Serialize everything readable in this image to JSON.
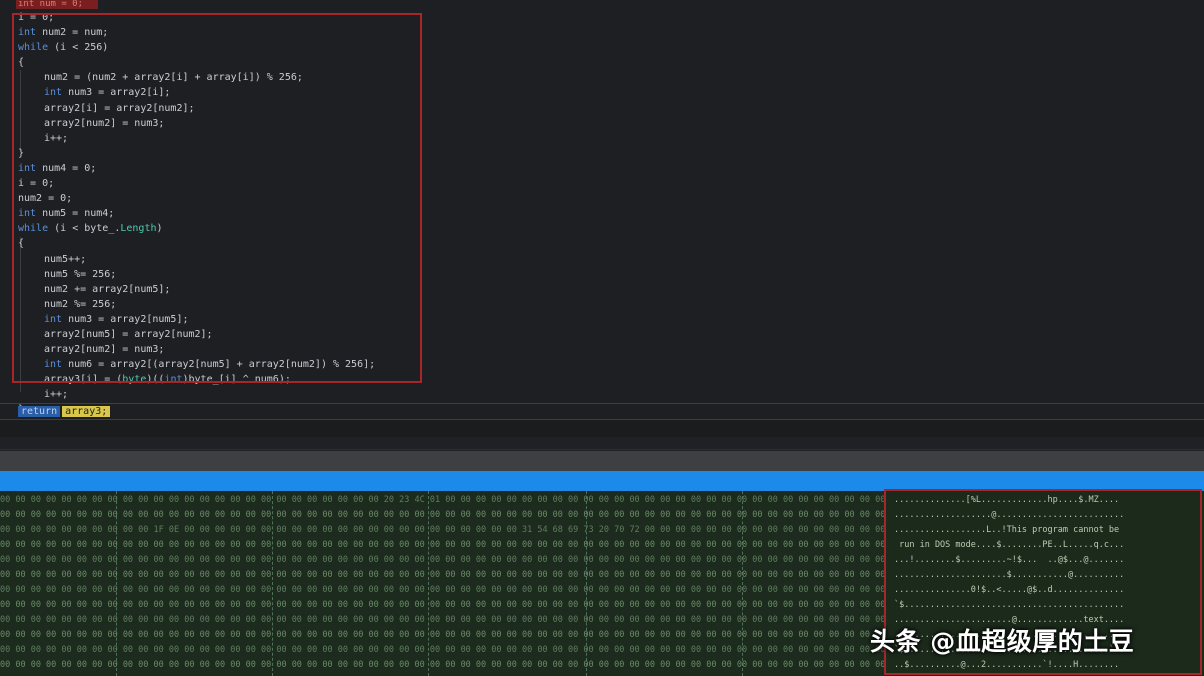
{
  "editor": {
    "top_line": "int num = 0;",
    "lines": [
      {
        "indent": 0,
        "parts": [
          {
            "t": "i = 0;"
          }
        ]
      },
      {
        "indent": 0,
        "parts": [
          {
            "k": "kw",
            "t": "int"
          },
          {
            "t": " num2 = num;"
          }
        ]
      },
      {
        "indent": 0,
        "parts": [
          {
            "k": "kw",
            "t": "while"
          },
          {
            "t": " (i < 256)"
          }
        ]
      },
      {
        "indent": 0,
        "parts": [
          {
            "t": "{"
          }
        ]
      },
      {
        "indent": 1,
        "parts": [
          {
            "t": "num2 = (num2 + array2[i] + array[i]) % 256;"
          }
        ]
      },
      {
        "indent": 1,
        "parts": [
          {
            "k": "kw",
            "t": "int"
          },
          {
            "t": " num3 = array2[i];"
          }
        ]
      },
      {
        "indent": 1,
        "parts": [
          {
            "t": "array2[i] = array2[num2];"
          }
        ]
      },
      {
        "indent": 1,
        "parts": [
          {
            "t": "array2[num2] = num3;"
          }
        ]
      },
      {
        "indent": 1,
        "parts": [
          {
            "t": "i++;"
          }
        ]
      },
      {
        "indent": 0,
        "parts": [
          {
            "t": "}"
          }
        ]
      },
      {
        "indent": 0,
        "parts": [
          {
            "k": "kw",
            "t": "int"
          },
          {
            "t": " num4 = 0;"
          }
        ]
      },
      {
        "indent": 0,
        "parts": [
          {
            "t": "i = 0;"
          }
        ]
      },
      {
        "indent": 0,
        "parts": [
          {
            "t": "num2 = 0;"
          }
        ]
      },
      {
        "indent": 0,
        "parts": [
          {
            "k": "kw",
            "t": "int"
          },
          {
            "t": " num5 = num4;"
          }
        ]
      },
      {
        "indent": 0,
        "parts": [
          {
            "k": "kw",
            "t": "while"
          },
          {
            "t": " (i < byte_."
          },
          {
            "k": "type",
            "t": "Length"
          },
          {
            "t": ")"
          }
        ]
      },
      {
        "indent": 0,
        "parts": [
          {
            "t": "{"
          }
        ]
      },
      {
        "indent": 1,
        "parts": [
          {
            "t": "num5++;"
          }
        ]
      },
      {
        "indent": 1,
        "parts": [
          {
            "t": "num5 %= 256;"
          }
        ]
      },
      {
        "indent": 1,
        "parts": [
          {
            "t": "num2 += array2[num5];"
          }
        ]
      },
      {
        "indent": 1,
        "parts": [
          {
            "t": "num2 %= 256;"
          }
        ]
      },
      {
        "indent": 1,
        "parts": [
          {
            "k": "kw",
            "t": "int"
          },
          {
            "t": " num3 = array2[num5];"
          }
        ]
      },
      {
        "indent": 1,
        "parts": [
          {
            "t": "array2[num5] = array2[num2];"
          }
        ]
      },
      {
        "indent": 1,
        "parts": [
          {
            "t": "array2[num2] = num3;"
          }
        ]
      },
      {
        "indent": 1,
        "parts": [
          {
            "k": "kw",
            "t": "int"
          },
          {
            "t": " num6 = array2[(array2[num5] + array2[num2]) % 256];"
          }
        ]
      },
      {
        "indent": 1,
        "parts": [
          {
            "t": "array3[i] = ("
          },
          {
            "k": "type",
            "t": "byte"
          },
          {
            "t": ")(("
          },
          {
            "k": "kw",
            "t": "int"
          },
          {
            "t": ")byte_[i] ^ num6);"
          }
        ]
      },
      {
        "indent": 1,
        "parts": [
          {
            "t": "i++;"
          }
        ]
      },
      {
        "indent": 0,
        "parts": [
          {
            "t": "}"
          }
        ]
      }
    ],
    "return_keyword": "return",
    "return_value": "array3;"
  },
  "hex": {
    "rows": [
      "00 00 00 00 00 00 00 00 00 00 00 00 00 00 00 00 00 00 00 00 00 00 00 00 00 20 23 4C 01 00 00 00 00 00 00 00 00 00 00 00 00 00 00 00 00 00 00 00 00 00 00 00 00 00 00 00 00 00 00 00 00 00 00 00 00 00 00",
      "00 00 00 00 00 00 00 00 00 00 00 00 00 00 00 00 00 00 00 00 00 00 00 00 00 00 00 00 00 00 00 00 00 00 00 00 00 00 00 00 00 00 00 00 00 00 00 00 00 00 00 00 00 00 00 00 00 00 00 00 00 00 00 00 00 00 00",
      "00 00 00 00 00 00 00 00 00 00 1F 0E 00 00 00 00 00 00 00 00 00 00 00 00 00 00 00 00 00 00 00 00 00 00 31 54 68 69 73 20 70 72 00 00 00 00 00 00 00 00 00 00 00 00 00 00 00 00 00 00 00 00 00 00 00 00 00",
      "00 00 00 00 00 00 00 00 00 00 00 00 00 00 00 00 00 00 00 00 00 00 00 00 00 00 00 00 00 00 00 00 00 00 00 00 00 00 00 00 00 00 00 00 00 00 00 00 00 00 00 00 00 00 00 00 00 00 00 00 00 00 00 00 00 00 00",
      "00 00 00 00 00 00 00 00 00 00 00 00 00 00 00 00 00 00 00 00 00 00 00 00 00 00 00 00 00 00 00 00 00 00 00 00 00 00 00 00 00 00 00 00 00 00 00 00 00 00 00 00 00 00 00 00 00 00 00 00 00 00 00 00 00 00 00",
      "00 00 00 00 00 00 00 00 00 00 00 00 00 00 00 00 00 00 00 00 00 00 00 00 00 00 00 00 00 00 00 00 00 00 00 00 00 00 00 00 00 00 00 00 00 00 00 00 00 00 00 00 00 00 00 00 00 00 00 00 00 00 00 00 00 00 00",
      "00 00 00 00 00 00 00 00 00 00 00 00 00 00 00 00 00 00 00 00 00 00 00 00 00 00 00 00 00 00 00 00 00 00 00 00 00 00 00 00 00 00 00 00 00 00 00 00 00 00 00 00 00 00 00 00 00 00 00 00 00 00 00 00 00 00 00",
      "00 00 00 00 00 00 00 00 00 00 00 00 00 00 00 00 00 00 00 00 00 00 00 00 00 00 00 00 00 00 00 00 00 00 00 00 00 00 00 00 00 00 00 00 00 00 00 00 00 00 00 00 00 00 00 00 00 00 00 00 00 00 00 00 00 00 00",
      "00 00 00 00 00 00 00 00 00 00 00 00 00 00 00 00 00 00 00 00 00 00 00 00 00 00 00 00 00 00 00 00 00 00 00 00 00 00 00 00 00 00 00 00 00 00 00 00 00 00 00 00 00 00 00 00 00 00 00 00 00 00 00 00 00 00 00",
      "00 00 00 00 00 00 00 00 00 00 00 00 00 00 00 00 00 00 00 00 00 00 00 00 00 00 00 00 00 00 00 00 00 00 00 00 00 00 00 00 00 00 00 00 00 00 00 00 00 00 00 00 00 00 00 00 00 00 00 00 00 00 00 00 00 00 00",
      "00 00 00 00 00 00 00 00 00 00 00 00 00 00 00 00 00 00 00 00 00 00 00 00 00 00 00 00 00 00 00 00 00 00 00 00 00 00 00 00 00 00 00 00 00 00 00 00 00 00 00 00 00 00 00 00 00 00 00 00 00 00 00 00 00 00 00",
      "00 00 00 00 00 00 00 00 00 00 00 00 00 00 00 00 00 00 00 00 00 00 00 00 00 00 00 00 00 00 00 00 00 00 00 00 00 00 00 00 00 00 00 00 00 00 00 00 00 00 00 00 00 00 00 00 00 00 00 00 00 00 00 00 00 00 00"
    ],
    "ascii_rows": [
      "..............[%L.............hp....$.MZ....",
      "...................@.........................",
      "..................L..!This program cannot be",
      " run in DOS mode....$........PE..L.....q.c...",
      "...!........$.........~!$...  ..@$...@.......",
      "......................$...........@..........",
      "...............0!$..<.....@$..d..............",
      "`$...........................................",
      ".......................@.............text....",
      "..............................................",
      "`$........................................`..",
      "..$..........@...2...........`!....H........"
    ]
  },
  "watermark": "头条 @血超级厚的土豆"
}
